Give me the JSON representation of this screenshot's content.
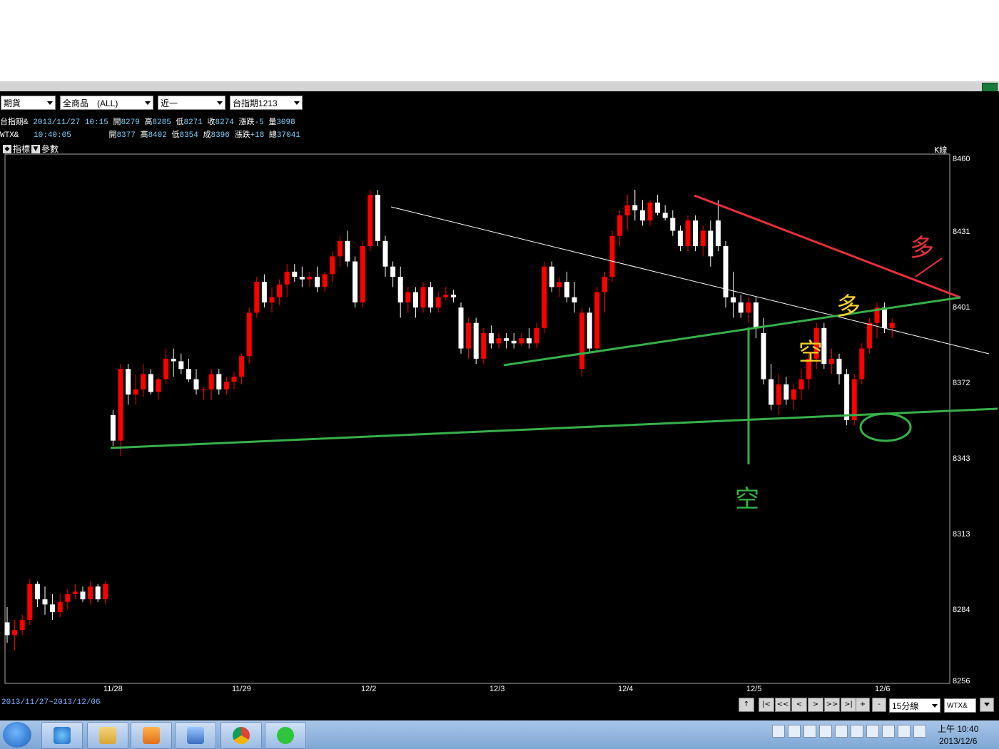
{
  "toolbar": {
    "market": "期貨",
    "product": "全商品　(ALL)",
    "period": "近一",
    "contract": "台指期1213"
  },
  "quotes": [
    {
      "name": "台指期&",
      "time": "2013/11/27  10:15",
      "open_l": "開",
      "open": "8279",
      "high_l": "高",
      "high": "8285",
      "low_l": "低",
      "low": "8271",
      "close_l": "收",
      "close": "8274",
      "chg_l": "漲跌",
      "chg": "-5",
      "vol_l": "量",
      "vol": "3098"
    },
    {
      "name": "WTX&",
      "time": "10:40:05",
      "open_l": "開",
      "open": "8377",
      "high_l": "高",
      "high": "8402",
      "low_l": "低",
      "low": "8354",
      "close_l": "成",
      "close": "8396",
      "chg_l": "漲跌",
      "chg": "+18",
      "vol_l": "總",
      "vol": "37041"
    }
  ],
  "indicator_bar": {
    "indicator": "指標",
    "params": "參數",
    "kline": "K線"
  },
  "footer": {
    "range": "2013/11/27~2013/12/06",
    "interval": "15分線",
    "symbol": "WTX&",
    "nav_buttons": [
      "↑",
      "|<",
      "<<",
      "<",
      ">",
      ">>",
      ">|",
      "+",
      "-"
    ]
  },
  "annotations": {
    "bull_red": "多",
    "bull_yellow": "多",
    "bear_yellow": "空",
    "bear_green": "空"
  },
  "chart_data": {
    "type": "candlestick",
    "title": "",
    "xlabel": "",
    "ylabel": "",
    "ylim": [
      8256,
      8460
    ],
    "y_ticks": [
      "8460",
      "8431",
      "8401",
      "8372",
      "8343",
      "8313",
      "8284",
      "8256"
    ],
    "x_ticks": [
      "11/28",
      "11/29",
      "12/2",
      "12/3",
      "12/4",
      "12/5",
      "12/6"
    ],
    "colors": {
      "up": "#ff0000",
      "down": "#ffffff",
      "background": "#000000"
    },
    "candles": [
      [
        8279,
        8285,
        8271,
        8274
      ],
      [
        8274,
        8280,
        8268,
        8276
      ],
      [
        8276,
        8282,
        8274,
        8280
      ],
      [
        8280,
        8296,
        8278,
        8294
      ],
      [
        8294,
        8295,
        8285,
        8288
      ],
      [
        8288,
        8293,
        8282,
        8286
      ],
      [
        8286,
        8290,
        8280,
        8283
      ],
      [
        8283,
        8290,
        8281,
        8287
      ],
      [
        8287,
        8292,
        8284,
        8290
      ],
      [
        8290,
        8294,
        8288,
        8291
      ],
      [
        8291,
        8293,
        8287,
        8288
      ],
      [
        8288,
        8295,
        8286,
        8293
      ],
      [
        8293,
        8294,
        8287,
        8288
      ],
      [
        8288,
        8295,
        8286,
        8294
      ],
      [
        8360,
        8362,
        8348,
        8350
      ],
      [
        8350,
        8380,
        8344,
        8378
      ],
      [
        8378,
        8380,
        8364,
        8368
      ],
      [
        8368,
        8376,
        8364,
        8370
      ],
      [
        8370,
        8380,
        8367,
        8376
      ],
      [
        8376,
        8378,
        8368,
        8369
      ],
      [
        8369,
        8375,
        8366,
        8374
      ],
      [
        8374,
        8386,
        8372,
        8382
      ],
      [
        8382,
        8386,
        8375,
        8381
      ],
      [
        8381,
        8384,
        8376,
        8378
      ],
      [
        8378,
        8382,
        8373,
        8374
      ],
      [
        8374,
        8378,
        8368,
        8370
      ],
      [
        8370,
        8371,
        8366,
        8370
      ],
      [
        8370,
        8378,
        8366,
        8376
      ],
      [
        8376,
        8378,
        8368,
        8370
      ],
      [
        8370,
        8375,
        8368,
        8373
      ],
      [
        8373,
        8377,
        8370,
        8375
      ],
      [
        8375,
        8384,
        8372,
        8383
      ],
      [
        8383,
        8402,
        8380,
        8400
      ],
      [
        8400,
        8414,
        8398,
        8412
      ],
      [
        8412,
        8415,
        8402,
        8404
      ],
      [
        8404,
        8410,
        8400,
        8406
      ],
      [
        8406,
        8413,
        8403,
        8411
      ],
      [
        8411,
        8419,
        8406,
        8416
      ],
      [
        8416,
        8419,
        8412,
        8414
      ],
      [
        8414,
        8418,
        8410,
        8413
      ],
      [
        8413,
        8416,
        8410,
        8414
      ],
      [
        8414,
        8418,
        8408,
        8410
      ],
      [
        8410,
        8416,
        8408,
        8415
      ],
      [
        8415,
        8424,
        8412,
        8422
      ],
      [
        8422,
        8430,
        8418,
        8428
      ],
      [
        8428,
        8432,
        8418,
        8420
      ],
      [
        8420,
        8422,
        8402,
        8404
      ],
      [
        8404,
        8428,
        8402,
        8426
      ],
      [
        8426,
        8448,
        8424,
        8446
      ],
      [
        8446,
        8448,
        8426,
        8428
      ],
      [
        8428,
        8430,
        8414,
        8418
      ],
      [
        8418,
        8420,
        8410,
        8414
      ],
      [
        8414,
        8418,
        8398,
        8404
      ],
      [
        8404,
        8410,
        8400,
        8408
      ],
      [
        8408,
        8410,
        8398,
        8402
      ],
      [
        8402,
        8412,
        8400,
        8410
      ],
      [
        8410,
        8412,
        8400,
        8402
      ],
      [
        8402,
        8408,
        8400,
        8406
      ],
      [
        8406,
        8410,
        8405,
        8407
      ],
      [
        8407,
        8409,
        8404,
        8406
      ],
      [
        8402,
        8404,
        8384,
        8386
      ],
      [
        8386,
        8398,
        8382,
        8396
      ],
      [
        8396,
        8398,
        8380,
        8382
      ],
      [
        8382,
        8394,
        8380,
        8392
      ],
      [
        8392,
        8395,
        8386,
        8388
      ],
      [
        8388,
        8392,
        8386,
        8390
      ],
      [
        8390,
        8392,
        8386,
        8389
      ],
      [
        8389,
        8392,
        8386,
        8388
      ],
      [
        8388,
        8392,
        8387,
        8390
      ],
      [
        8390,
        8394,
        8386,
        8388
      ],
      [
        8388,
        8396,
        8386,
        8394
      ],
      [
        8394,
        8420,
        8392,
        8418
      ],
      [
        8418,
        8420,
        8408,
        8410
      ],
      [
        8410,
        8414,
        8406,
        8412
      ],
      [
        8412,
        8416,
        8404,
        8406
      ],
      [
        8406,
        8412,
        8400,
        8404
      ],
      [
        8378,
        8402,
        8375,
        8400
      ],
      [
        8400,
        8402,
        8384,
        8386
      ],
      [
        8386,
        8410,
        8384,
        8408
      ],
      [
        8408,
        8416,
        8400,
        8414
      ],
      [
        8414,
        8432,
        8412,
        8430
      ],
      [
        8430,
        8440,
        8426,
        8438
      ],
      [
        8438,
        8446,
        8432,
        8442
      ],
      [
        8442,
        8448,
        8436,
        8440
      ],
      [
        8440,
        8444,
        8434,
        8436
      ],
      [
        8436,
        8444,
        8434,
        8443
      ],
      [
        8443,
        8446,
        8438,
        8439
      ],
      [
        8439,
        8442,
        8436,
        8437
      ],
      [
        8437,
        8440,
        8430,
        8432
      ],
      [
        8432,
        8434,
        8424,
        8426
      ],
      [
        8426,
        8438,
        8424,
        8436
      ],
      [
        8436,
        8438,
        8424,
        8426
      ],
      [
        8426,
        8434,
        8422,
        8432
      ],
      [
        8432,
        8436,
        8418,
        8422
      ],
      [
        8436,
        8444,
        8424,
        8426
      ],
      [
        8426,
        8428,
        8402,
        8406
      ],
      [
        8406,
        8416,
        8398,
        8404
      ],
      [
        8404,
        8407,
        8398,
        8400
      ],
      [
        8400,
        8406,
        8396,
        8404
      ],
      [
        8404,
        8406,
        8390,
        8394
      ],
      [
        8392,
        8398,
        8372,
        8374
      ],
      [
        8374,
        8380,
        8362,
        8364
      ],
      [
        8364,
        8376,
        8360,
        8372
      ],
      [
        8372,
        8375,
        8364,
        8366
      ],
      [
        8366,
        8372,
        8362,
        8370
      ],
      [
        8370,
        8378,
        8366,
        8374
      ],
      [
        8374,
        8384,
        8370,
        8382
      ],
      [
        8382,
        8396,
        8378,
        8394
      ],
      [
        8394,
        8396,
        8378,
        8380
      ],
      [
        8380,
        8386,
        8376,
        8382
      ],
      [
        8382,
        8384,
        8372,
        8376
      ],
      [
        8376,
        8378,
        8356,
        8358
      ],
      [
        8358,
        8376,
        8356,
        8374
      ],
      [
        8374,
        8388,
        8372,
        8386
      ],
      [
        8386,
        8398,
        8384,
        8396
      ],
      [
        8396,
        8404,
        8390,
        8402
      ],
      [
        8402,
        8404,
        8392,
        8394
      ],
      [
        8394,
        8398,
        8390,
        8396
      ]
    ]
  }
}
